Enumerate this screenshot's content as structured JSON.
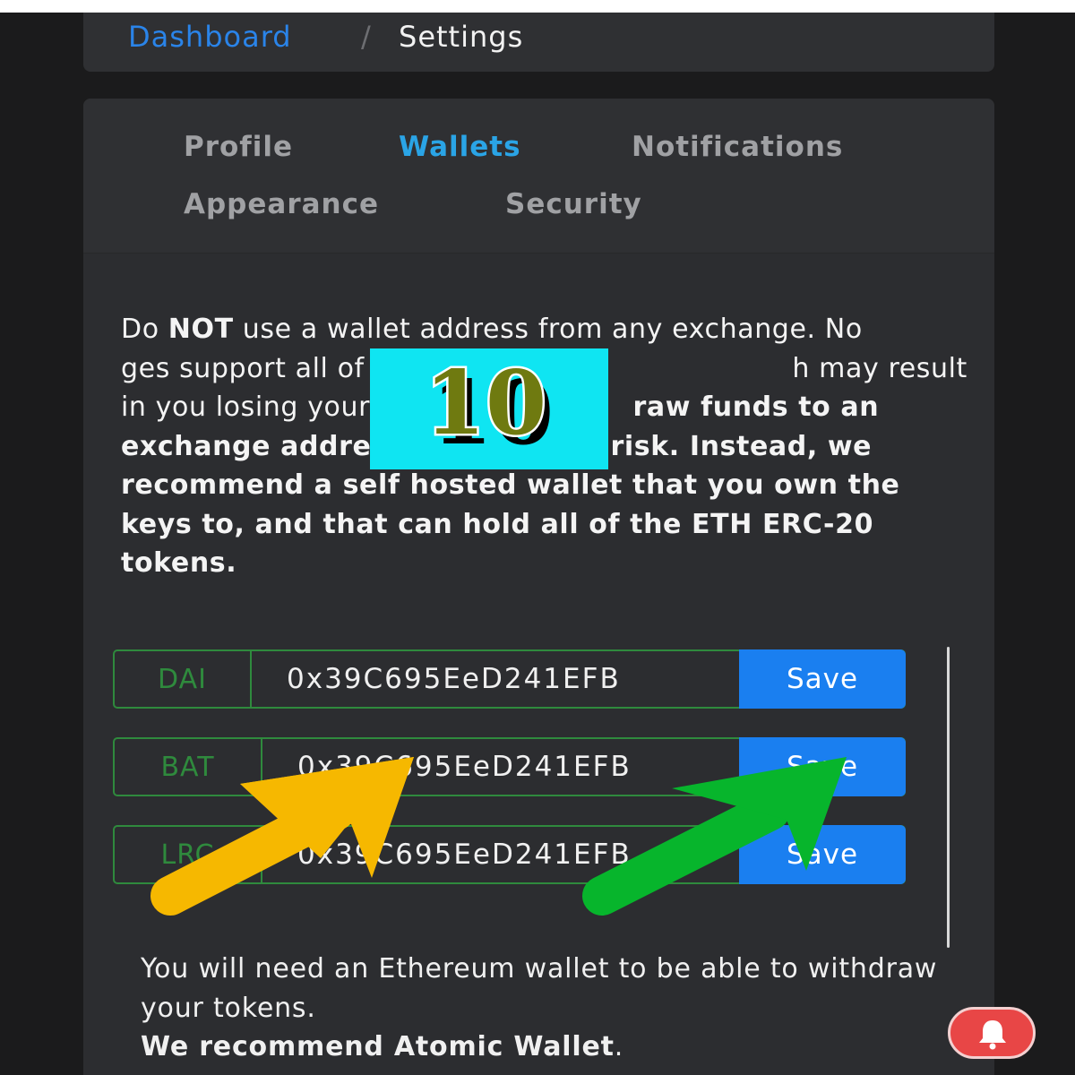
{
  "breadcrumb": {
    "parent": "Dashboard",
    "separator": "/",
    "current": "Settings"
  },
  "tabs": {
    "profile": "Profile",
    "wallets": "Wallets",
    "notifications": "Notifications",
    "appearance": "Appearance",
    "security": "Security",
    "active": "Wallets"
  },
  "warning": {
    "p1_before": "Do ",
    "p1_strong": "NOT",
    "p1_after": " use a wallet address from any exchange. No",
    "p2": "ges support all of the tokens w",
    "p3": "h may result in you losing your to",
    "p4_bold": "raw funds to an exchange address at your own risk. Instead, we recommend a self hosted wallet that you own the keys to, and that can hold all of the ETH ERC-20 tokens."
  },
  "wallets": [
    {
      "token": "DAI",
      "address": "0x39C695EeD241EFB",
      "save": "Save"
    },
    {
      "token": "BAT",
      "address": "0x39C695EeD241EFB",
      "save": "Save"
    },
    {
      "token": "LRC",
      "address": "0x39C695EeD241EFB",
      "save": "Save"
    }
  ],
  "footer": {
    "line1": "You will need an Ethereum wallet to be able to withdraw your tokens.",
    "line2_bold": "We recommend Atomic Wallet",
    "line2_end": "."
  },
  "overlay": {
    "badge_number": "10",
    "arrow_colors": [
      "#f6b800",
      "#07b52c"
    ]
  },
  "icons": {
    "notification": "bell-icon"
  },
  "colors": {
    "accent_blue": "#1a7ff0",
    "link_blue": "#2a84e9",
    "tab_active": "#2aa4e6",
    "wallet_border": "#2f8a3d",
    "alert_red": "#e84646"
  }
}
